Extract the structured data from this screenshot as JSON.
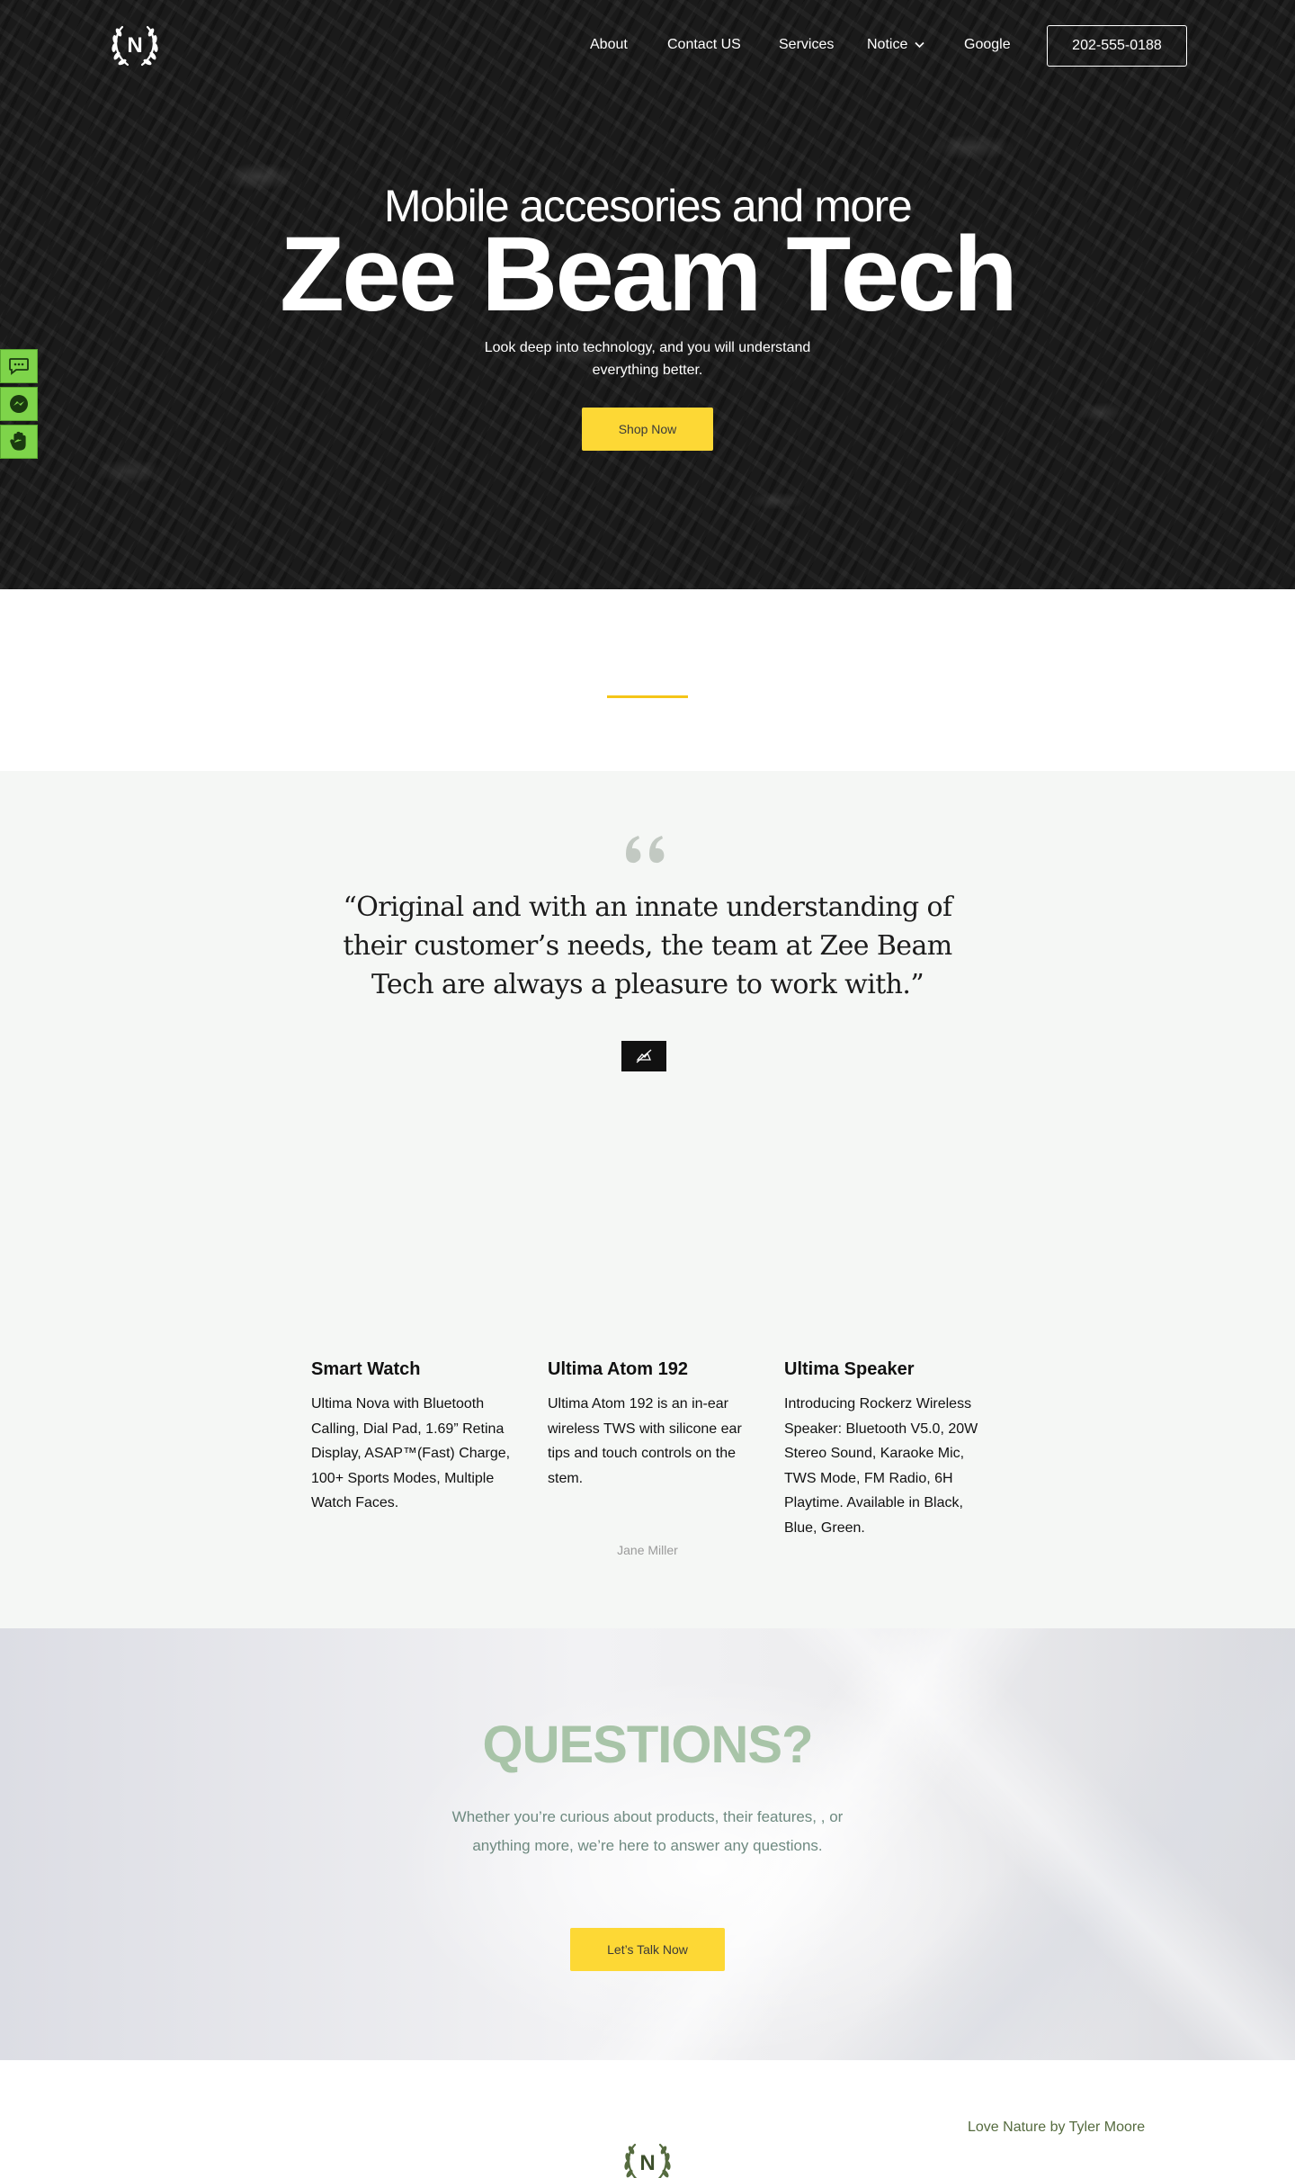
{
  "header": {
    "logo_letter": "N",
    "nav": {
      "about": "About",
      "contact": "Contact US",
      "services": "Services",
      "notice": "Notice",
      "google": "Google"
    },
    "phone": "202-555-0188"
  },
  "hero": {
    "subtitle": "Mobile accesories and more",
    "title": "Zee Beam Tech",
    "description": "Look deep into technology, and you will understand everything better.",
    "cta": "Shop Now"
  },
  "side_buttons": {
    "icons": [
      "chat-bubble-icon",
      "messenger-icon",
      "hand-icon"
    ]
  },
  "testimonial": {
    "quote": "“Original and with an innate understanding of their customer’s needs, the team at Zee Beam Tech are always a pleasure to work with.”",
    "author": "Jane Miller",
    "products": [
      {
        "title": "Smart Watch",
        "description": "Ultima Nova with Bluetooth Calling, Dial Pad, 1.69” Retina Display, ASAP™(Fast) Charge, 100+ Sports Modes, Multiple Watch Faces."
      },
      {
        "title": "Ultima Atom 192",
        "description": "Ultima Atom 192 is an in-ear wireless TWS with silicone ear tips and touch controls on the stem."
      },
      {
        "title": "Ultima Speaker",
        "description": "Introducing Rockerz Wireless Speaker: Bluetooth V5.0, 20W Stereo Sound, Karaoke Mic, TWS Mode, FM Radio, 6H Playtime. Available in Black, Blue, Green."
      }
    ]
  },
  "questions": {
    "title": "QUESTIONS?",
    "description": "Whether you’re curious about products, their features, , or anything more, we’re here to answer any questions.",
    "cta": "Let’s Talk Now"
  },
  "footer": {
    "logo_letter": "N",
    "credit": "Love Nature by Tyler Moore"
  },
  "colors": {
    "accent_yellow": "#fdd835",
    "divider_gold": "#f5c518",
    "side_green": "#7ed44a",
    "questions_title": "#a8c4a8",
    "footer_logo": "#556b3f"
  }
}
